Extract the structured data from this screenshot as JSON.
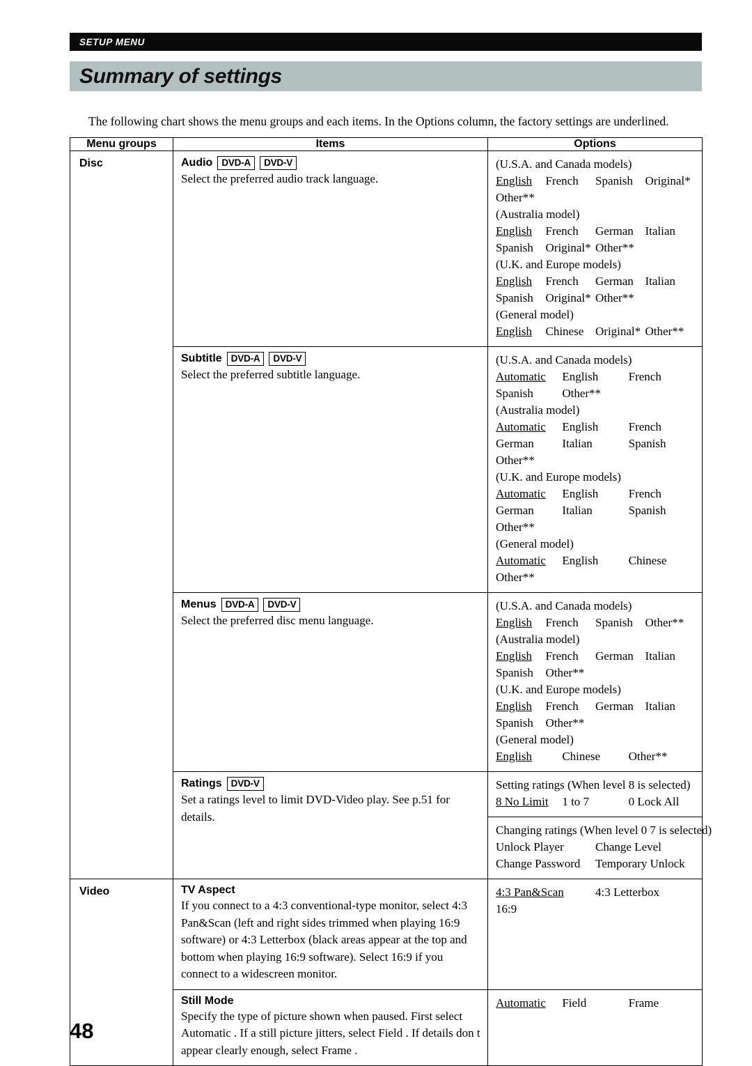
{
  "running_head": "SETUP MENU",
  "page_title": "Summary of settings",
  "intro": "The following chart shows the menu groups and each items. In the  Options  column, the factory settings are underlined.",
  "page_number": "48",
  "table": {
    "headers": {
      "menu_groups": "Menu groups",
      "items": "Items",
      "options": "Options"
    },
    "groups": [
      {
        "name": "Disc",
        "rows": [
          {
            "item_title": "Audio",
            "badges": [
              "DVD-A",
              "DVD-V"
            ],
            "item_desc": "Select the preferred audio track language.",
            "option_groups": [
              {
                "note": "(U.S.A. and Canada models)",
                "lines": [
                  [
                    "English",
                    "French",
                    "Spanish",
                    "Original*"
                  ],
                  [
                    "Other**"
                  ]
                ],
                "underlined": [
                  "English"
                ]
              },
              {
                "note": "(Australia model)",
                "lines": [
                  [
                    "English",
                    "French",
                    "German",
                    "Italian"
                  ],
                  [
                    "Spanish",
                    "Original*",
                    "Other**"
                  ]
                ],
                "underlined": [
                  "English"
                ]
              },
              {
                "note": "(U.K. and Europe models)",
                "lines": [
                  [
                    "English",
                    "French",
                    "German",
                    "Italian"
                  ],
                  [
                    "Spanish",
                    "Original*",
                    "Other**"
                  ]
                ],
                "underlined": [
                  "English"
                ]
              },
              {
                "note": "(General model)",
                "lines": [
                  [
                    "English",
                    "Chinese",
                    "Original*",
                    "Other**"
                  ]
                ],
                "underlined": [
                  "English"
                ]
              }
            ]
          },
          {
            "item_title": "Subtitle",
            "badges": [
              "DVD-A",
              "DVD-V"
            ],
            "item_desc": "Select the preferred subtitle language.",
            "option_groups": [
              {
                "note": "(U.S.A. and Canada models)",
                "lines": [
                  [
                    "Automatic",
                    "English",
                    "French"
                  ],
                  [
                    "Spanish",
                    "Other**"
                  ]
                ],
                "underlined": [
                  "Automatic"
                ]
              },
              {
                "note": "(Australia model)",
                "lines": [
                  [
                    "Automatic",
                    "English",
                    "French"
                  ],
                  [
                    "German",
                    "Italian",
                    "Spanish"
                  ],
                  [
                    "Other**"
                  ]
                ],
                "underlined": [
                  "Automatic"
                ]
              },
              {
                "note": "(U.K. and Europe models)",
                "lines": [
                  [
                    "Automatic",
                    "English",
                    "French"
                  ],
                  [
                    "German",
                    "Italian",
                    "Spanish"
                  ],
                  [
                    "Other**"
                  ]
                ],
                "underlined": [
                  "Automatic"
                ]
              },
              {
                "note": "(General model)",
                "lines": [
                  [
                    "Automatic",
                    "English",
                    "Chinese"
                  ],
                  [
                    "Other**"
                  ]
                ],
                "underlined": [
                  "Automatic"
                ]
              }
            ]
          },
          {
            "item_title": "Menus",
            "badges": [
              "DVD-A",
              "DVD-V"
            ],
            "item_desc": "Select the preferred disc menu language.",
            "option_groups": [
              {
                "note": "(U.S.A. and Canada models)",
                "lines": [
                  [
                    "English",
                    "French",
                    "Spanish",
                    "Other**"
                  ]
                ],
                "underlined": [
                  "English"
                ]
              },
              {
                "note": "(Australia model)",
                "lines": [
                  [
                    "English",
                    "French",
                    "German",
                    "Italian"
                  ],
                  [
                    "Spanish",
                    "Other**"
                  ]
                ],
                "underlined": [
                  "English"
                ]
              },
              {
                "note": "(U.K. and Europe models)",
                "lines": [
                  [
                    "English",
                    "French",
                    "German",
                    "Italian"
                  ],
                  [
                    "Spanish",
                    "Other**"
                  ]
                ],
                "underlined": [
                  "English"
                ]
              },
              {
                "note": "(General model)",
                "lines": [
                  [
                    "English",
                    "Chinese",
                    "Other**"
                  ]
                ],
                "underlined": [
                  "English"
                ]
              }
            ]
          },
          {
            "item_title": "Ratings",
            "badges": [
              "DVD-V"
            ],
            "item_desc": "Set a ratings level to limit DVD-Video play. See p.51 for details.",
            "option_sections": [
              {
                "note": "Setting ratings (When level 8 is selected)",
                "lines": [
                  [
                    "8 No Limit",
                    "1 to 7",
                    "0 Lock All"
                  ]
                ],
                "underlined": [
                  "8 No Limit"
                ]
              },
              {
                "note": "Changing ratings (When level 0  7 is selected)",
                "lines": [
                  [
                    "Unlock Player",
                    "Change Level"
                  ],
                  [
                    "Change Password",
                    "Temporary Unlock"
                  ]
                ],
                "underlined": []
              }
            ]
          }
        ]
      },
      {
        "name": "Video",
        "rows": [
          {
            "item_title": "TV Aspect",
            "badges": [],
            "item_desc": "If you connect to a 4:3 conventional-type monitor, select  4:3 Pan&Scan  (left and right sides trimmed when playing 16:9 software) or  4:3 Letterbox  (black areas appear at the top and bottom when playing 16:9 software). Select  16:9  if you connect to a widescreen monitor.",
            "option_groups": [
              {
                "note": "",
                "lines": [
                  [
                    "4:3 Pan&Scan",
                    "4:3 Letterbox"
                  ],
                  [
                    "16:9"
                  ]
                ],
                "underlined": [
                  "4:3 Pan&Scan"
                ]
              }
            ]
          },
          {
            "item_title": "Still Mode",
            "badges": [],
            "item_desc": "Specify the type of picture shown when paused. First select  Automatic . If a still picture jitters, select  Field . If details don t appear clearly enough, select  Frame .",
            "option_groups": [
              {
                "note": "",
                "lines": [
                  [
                    "Automatic",
                    "Field",
                    "Frame"
                  ]
                ],
                "underlined": [
                  "Automatic"
                ]
              }
            ]
          }
        ]
      }
    ]
  }
}
